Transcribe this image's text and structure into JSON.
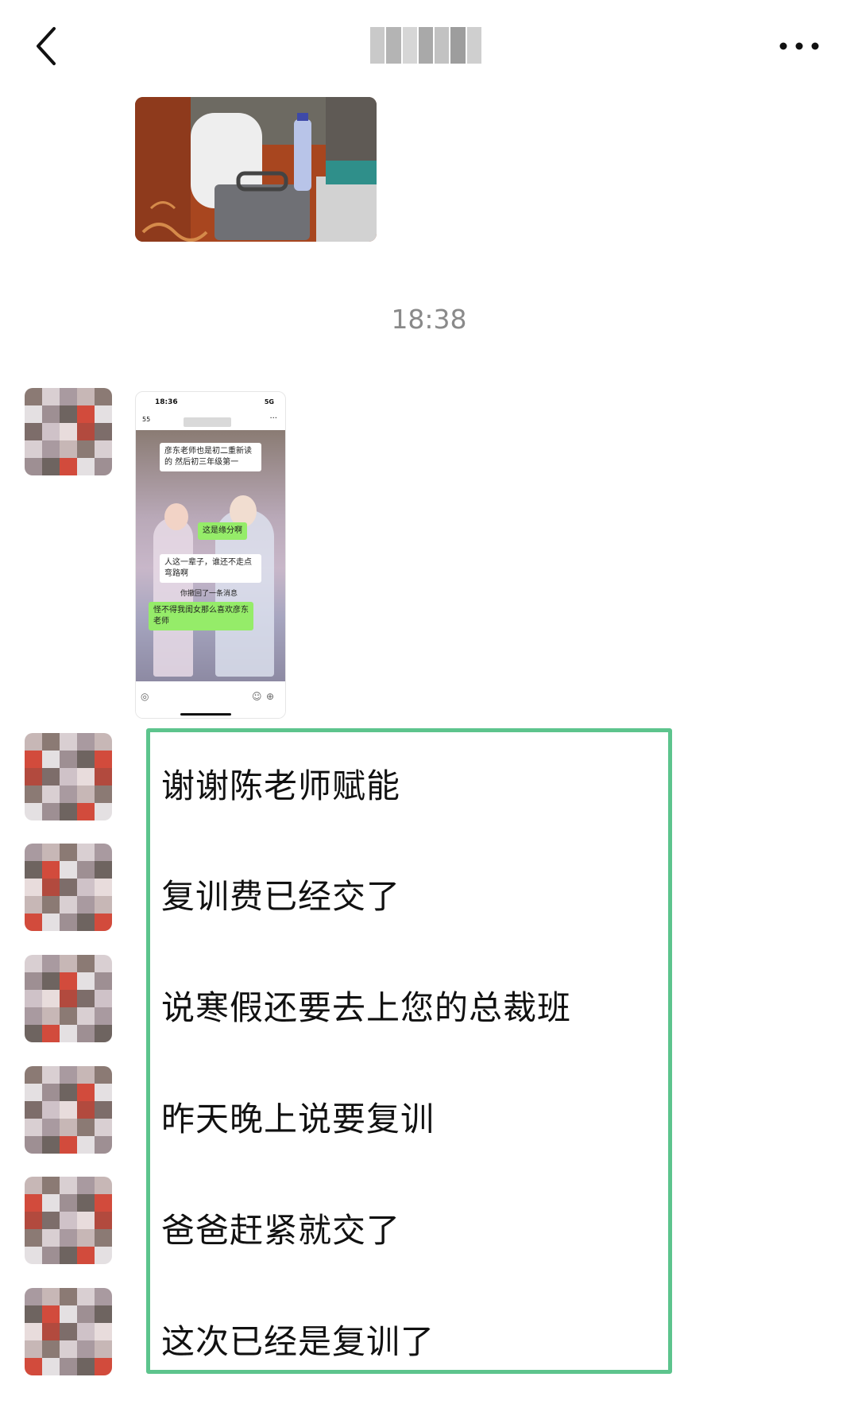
{
  "header": {
    "back_icon": "chevron-left-icon",
    "more_icon": "more-dots-icon",
    "more_glyph": "•••"
  },
  "timestamp": "18:38",
  "screenshot": {
    "status_time": "18:36",
    "status_signal": "5G",
    "nav_back": "55",
    "messages": [
      {
        "text": "彦东老师也是初二重新读的 然后初三年级第一",
        "kind": "white"
      },
      {
        "text": "这是缘分啊",
        "kind": "green"
      },
      {
        "text": "人这一辈子，谁还不走点弯路啊",
        "kind": "white"
      },
      {
        "text": "你撤回了一条消息",
        "kind": "system"
      },
      {
        "text": "怪不得我闺女那么喜欢彦东老师",
        "kind": "green"
      }
    ]
  },
  "messages": [
    "谢谢陈老师赋能",
    "复训费已经交了",
    "说寒假还要去上您的总裁班",
    "昨天晚上说要复训",
    "爸爸赶紧就交了",
    "这次已经是复训了"
  ]
}
